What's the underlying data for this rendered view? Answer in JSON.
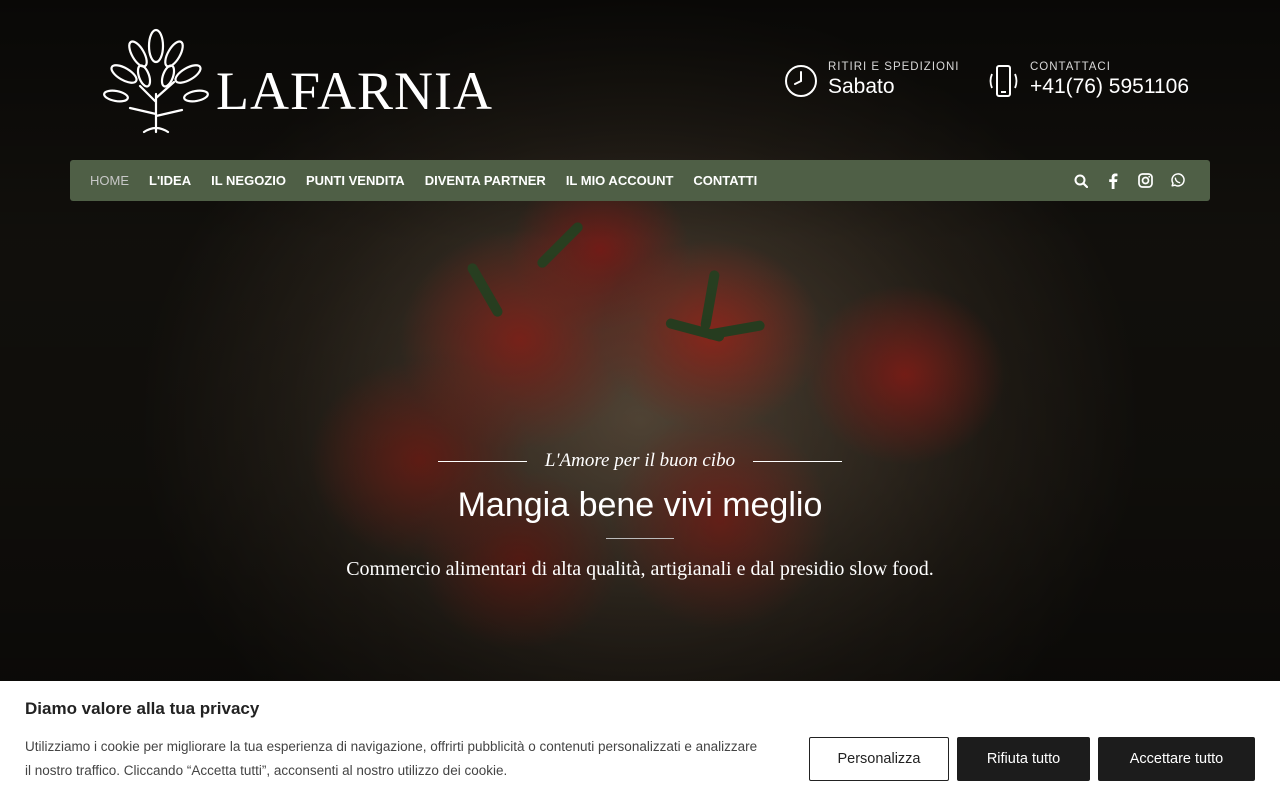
{
  "brand": {
    "name": "LAFARNIA"
  },
  "header_info": {
    "pickup": {
      "label": "RITIRI E SPEDIZIONI",
      "value": "Sabato",
      "icon": "clock-icon"
    },
    "contact": {
      "label": "CONTATTACI",
      "value": "+41(76) 5951106",
      "icon": "phone-icon"
    }
  },
  "nav": {
    "items": [
      {
        "label": "HOME",
        "active": true
      },
      {
        "label": "L'IDEA"
      },
      {
        "label": "IL NEGOZIO"
      },
      {
        "label": "PUNTI VENDITA"
      },
      {
        "label": "DIVENTA PARTNER"
      },
      {
        "label": "IL MIO ACCOUNT"
      },
      {
        "label": "CONTATTI"
      }
    ],
    "icons": [
      "search-icon",
      "facebook-icon",
      "instagram-icon",
      "whatsapp-icon"
    ]
  },
  "hero": {
    "tagline": "L'Amore per il buon cibo",
    "headline": "Mangia bene vivi meglio",
    "subline": "Commercio alimentari di alta qualità, artigianali e dal presidio slow food."
  },
  "cookie": {
    "title": "Diamo valore alla tua privacy",
    "text": "Utilizziamo i cookie per migliorare la tua esperienza di navigazione, offrirti pubblicità o contenuti personalizzati e analizzare il nostro traffico. Cliccando “Accetta tutti”, acconsenti al nostro utilizzo dei cookie.",
    "customize_label": "Personalizza",
    "reject_label": "Rifiuta tutto",
    "accept_label": "Accettare tutto"
  },
  "colors": {
    "nav_bg": "#4f5f46",
    "button_dark": "#1c1c1c"
  }
}
